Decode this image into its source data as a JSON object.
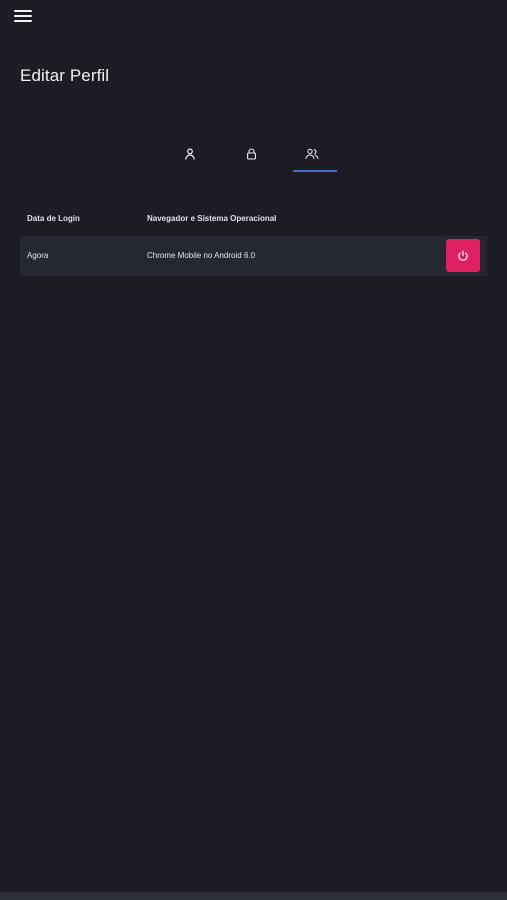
{
  "header": {
    "menu_icon": "hamburger-menu-icon",
    "title": "Editar Perfil"
  },
  "tabs": [
    {
      "id": "profile",
      "icon": "user-icon",
      "active": false
    },
    {
      "id": "security",
      "icon": "lock-icon",
      "active": false
    },
    {
      "id": "sessions",
      "icon": "users-icon",
      "active": true
    }
  ],
  "sessions": {
    "columns": {
      "login_date": "Data de Login",
      "browser_os": "Navegador e Sistema Operacional"
    },
    "rows": [
      {
        "login_date": "Agora",
        "browser_os": "Chrome Mobile no Android 6.0",
        "action_icon": "power-icon"
      }
    ]
  },
  "colors": {
    "background": "#1b1c24",
    "row_background": "#252833",
    "accent": "#4869c7",
    "danger": "#df2164",
    "bottom_bar": "#2e3039"
  }
}
